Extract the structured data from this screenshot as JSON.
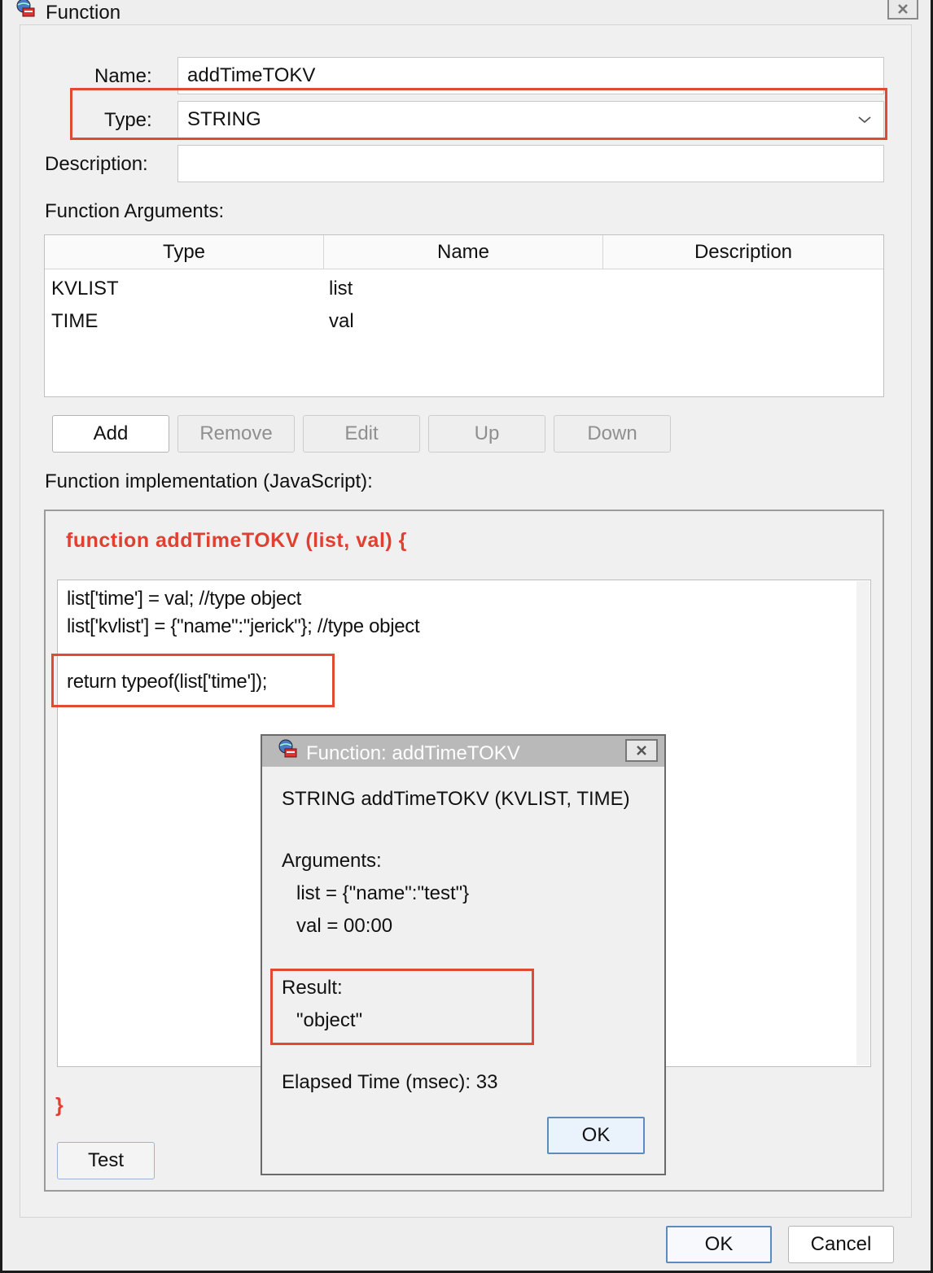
{
  "window": {
    "title": "Function",
    "icon": "function-globe-icon",
    "close_icon": "close-x-icon"
  },
  "form": {
    "name_label": "Name:",
    "name_value": "addTimeTOKV",
    "type_label": "Type:",
    "type_value": "STRING",
    "description_label": "Description:",
    "description_value": ""
  },
  "arguments": {
    "section_label": "Function Arguments:",
    "columns": [
      "Type",
      "Name",
      "Description"
    ],
    "rows": [
      {
        "type": "KVLIST",
        "name": "list",
        "description": ""
      },
      {
        "type": "TIME",
        "name": "val",
        "description": ""
      }
    ],
    "buttons": {
      "add": "Add",
      "remove": "Remove",
      "edit": "Edit",
      "up": "Up",
      "down": "Down"
    }
  },
  "implementation": {
    "section_label": "Function implementation (JavaScript):",
    "signature": "function addTimeTOKV (list, val) {",
    "code_lines": [
      "list['time'] = val; //type object",
      "list['kvlist'] = {\"name\":\"jerick\"}; //type object",
      "",
      "return typeof(list['time']);"
    ],
    "closing_brace": "}",
    "test_button": "Test"
  },
  "test_dialog": {
    "title": "Function: addTimeTOKV",
    "signature": "STRING addTimeTOKV (KVLIST, TIME)",
    "arguments_label": "Arguments:",
    "arguments": [
      "list = {\"name\":\"test\"}",
      "val = 00:00"
    ],
    "result_label": "Result:",
    "result_value": "\"object\"",
    "elapsed": "Elapsed Time (msec): 33",
    "ok_button": "OK"
  },
  "footer": {
    "ok_button": "OK",
    "cancel_button": "Cancel"
  },
  "colors": {
    "highlight_red": "#e04a33",
    "signature_red": "#e04030",
    "focus_blue": "#5c8bbf"
  }
}
